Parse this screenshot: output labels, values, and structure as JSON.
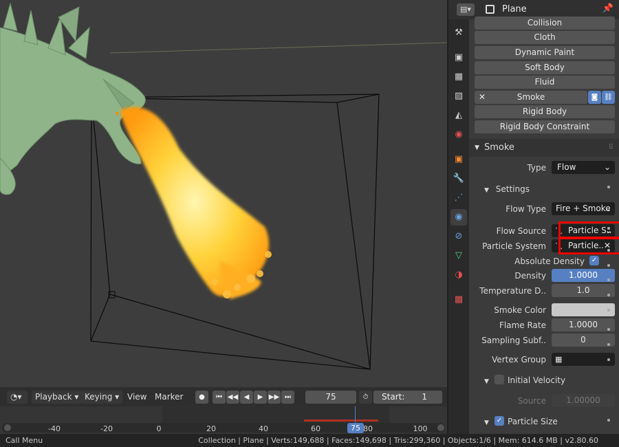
{
  "header": {
    "object_name": "Plane"
  },
  "physics_buttons": [
    "Collision",
    "Cloth",
    "Dynamic Paint",
    "Soft Body",
    "Fluid",
    "Smoke",
    "Rigid Body",
    "Rigid Body Constraint"
  ],
  "smoke": {
    "section_title": "Smoke",
    "type_label": "Type",
    "type_value": "Flow",
    "settings_title": "Settings",
    "flow_type_label": "Flow Type",
    "flow_type_value": "Fire + Smoke",
    "flow_source_label": "Flow Source",
    "flow_source_value": "Particle S..",
    "particle_system_label": "Particle System",
    "particle_system_value": "Particle..",
    "absolute_density_label": "Absolute Density",
    "density_label": "Density",
    "density_value": "1.0000",
    "temperature_label": "Temperature D..",
    "temperature_value": "1.0",
    "smoke_color_label": "Smoke Color",
    "flame_rate_label": "Flame Rate",
    "flame_rate_value": "1.0000",
    "sampling_label": "Sampling Subf..",
    "sampling_value": "0",
    "vertex_group_label": "Vertex Group",
    "initial_velocity_label": "Initial Velocity",
    "source_label": "Source",
    "source_value": "1.00000",
    "particle_size_label": "Particle Size"
  },
  "timeline": {
    "menus": [
      "Playback",
      "Keying",
      "View",
      "Marker"
    ],
    "current_frame": "75",
    "start_label": "Start:",
    "start_value": "1",
    "ticks": [
      "-40",
      "-20",
      "0",
      "20",
      "40",
      "60",
      "80",
      "100"
    ],
    "playhead_label": "75"
  },
  "status": {
    "left": "Call Menu",
    "right": "Collection | Plane | Verts:149,688 | Faces:149,698 | Tris:299,360 | Objects:1/6 | Mem: 614.6 MB | v2.80.60"
  },
  "colors": {
    "accent": "#5680c2",
    "highlight": "#ee0000",
    "timeline_playhead": "#5680c2"
  },
  "icons": [
    "editor-type-icon",
    "object-icon",
    "pin-icon",
    "tool-icon",
    "render-icon",
    "output-icon",
    "view-layer-icon",
    "scene-icon",
    "world-icon",
    "object-props-icon",
    "modifier-icon",
    "particles-icon",
    "physics-icon",
    "constraints-icon",
    "data-icon",
    "material-icon",
    "texture-icon",
    "camera-icon",
    "link-icon",
    "particle-icon",
    "close-icon",
    "vertex-group-icon",
    "stopwatch-icon"
  ]
}
